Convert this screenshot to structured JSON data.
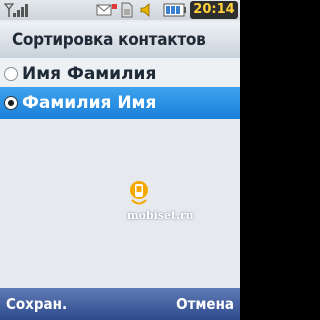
{
  "status_bar": {
    "time": "20:14",
    "icons": [
      "signal-icon",
      "envelope-icon",
      "sim-icon",
      "speaker-icon",
      "battery-icon"
    ]
  },
  "title": "Сортировка контактов",
  "options": [
    {
      "label": "Имя Фамилия",
      "selected": false
    },
    {
      "label": "Фамилия Имя",
      "selected": true
    }
  ],
  "watermark": {
    "text": "mobiset.ru"
  },
  "softkeys": {
    "left": "Сохран.",
    "right": "Отмена"
  },
  "colors": {
    "highlight": "#2a8fe4",
    "softkey_bar": "#3f5ea0",
    "clock_text": "#ffd23a",
    "background": "#e6e9ed"
  }
}
